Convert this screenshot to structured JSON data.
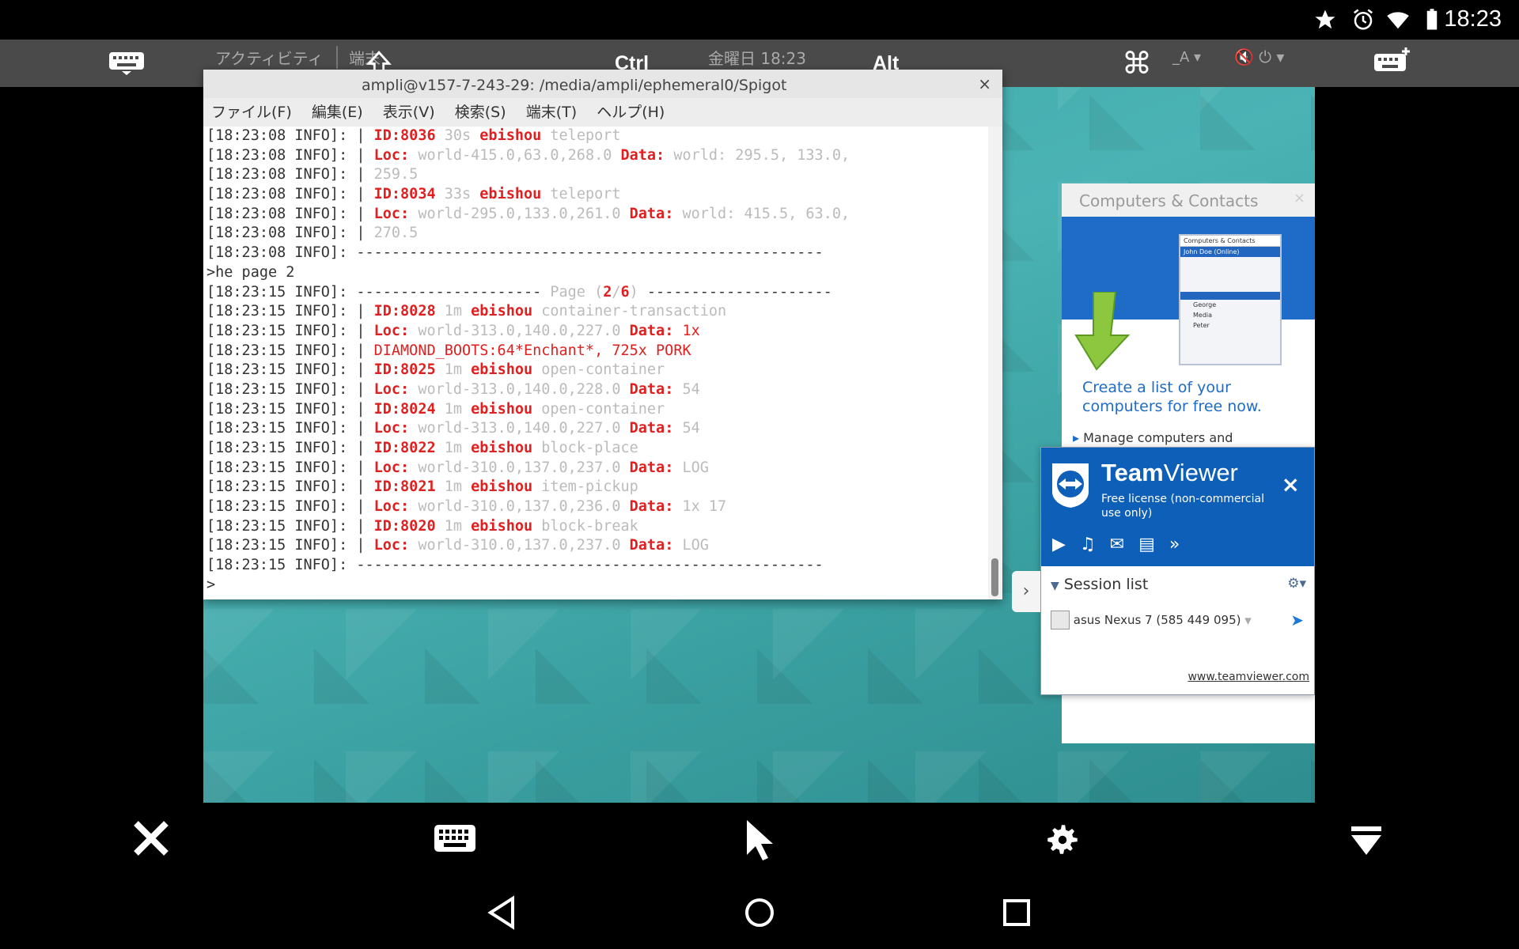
{
  "status_bar": {
    "time": "18:23",
    "icons": [
      "star-icon",
      "alarm-icon",
      "wifi-icon",
      "battery-icon"
    ]
  },
  "gnome_bar": {
    "activities": "アクティビティ",
    "app_menu": "端末",
    "clock": "金曜日 18:23"
  },
  "tv_toolbar": {
    "ctrl": "Ctrl",
    "alt": "Alt"
  },
  "terminal": {
    "title": "ampli@v157-7-243-29: /media/ampli/ephemeral0/Spigot",
    "menu": [
      "ファイル(F)",
      "編集(E)",
      "表示(V)",
      "検索(S)",
      "端末(T)",
      "ヘルプ(H)"
    ],
    "lines": [
      {
        "p": "[18:23:08 INFO]: | ",
        "s": [
          {
            "t": "ID:8036",
            "c": "red"
          },
          {
            "t": " 30s ",
            "c": "grey"
          },
          {
            "t": "ebishou",
            "c": "red"
          },
          {
            "t": " teleport",
            "c": "grey"
          }
        ]
      },
      {
        "p": "[18:23:08 INFO]: | ",
        "s": [
          {
            "t": "Loc:",
            "c": "red"
          },
          {
            "t": " world-415.0,63.0,268.0 ",
            "c": "grey"
          },
          {
            "t": "Data:",
            "c": "red"
          },
          {
            "t": " world: 295.5, 133.0,",
            "c": "grey"
          }
        ]
      },
      {
        "p": "[18:23:08 INFO]: | ",
        "s": [
          {
            "t": "259.5",
            "c": "grey"
          }
        ]
      },
      {
        "p": "[18:23:08 INFO]: | ",
        "s": [
          {
            "t": "ID:8034",
            "c": "red"
          },
          {
            "t": " 33s ",
            "c": "grey"
          },
          {
            "t": "ebishou",
            "c": "red"
          },
          {
            "t": " teleport",
            "c": "grey"
          }
        ]
      },
      {
        "p": "[18:23:08 INFO]: | ",
        "s": [
          {
            "t": "Loc:",
            "c": "red"
          },
          {
            "t": " world-295.0,133.0,261.0 ",
            "c": "grey"
          },
          {
            "t": "Data:",
            "c": "red"
          },
          {
            "t": " world: 415.5, 63.0,",
            "c": "grey"
          }
        ]
      },
      {
        "p": "[18:23:08 INFO]: | ",
        "s": [
          {
            "t": "270.5",
            "c": "grey"
          }
        ]
      },
      {
        "p": "[18:23:08 INFO]: -----------------------------------------------------",
        "s": []
      },
      {
        "p": ">he page 2",
        "s": []
      },
      {
        "p": "[18:23:15 INFO]: --------------------- ",
        "s": [
          {
            "t": "Page (",
            "c": "grey"
          },
          {
            "t": "2",
            "c": "red"
          },
          {
            "t": "/",
            "c": "grey"
          },
          {
            "t": "6",
            "c": "red"
          },
          {
            "t": ")",
            "c": "grey"
          },
          {
            "t": " ---------------------",
            "c": ""
          }
        ]
      },
      {
        "p": "[18:23:15 INFO]: | ",
        "s": [
          {
            "t": "ID:8028",
            "c": "red"
          },
          {
            "t": " 1m ",
            "c": "grey"
          },
          {
            "t": "ebishou",
            "c": "red"
          },
          {
            "t": " container-transaction",
            "c": "grey"
          }
        ]
      },
      {
        "p": "[18:23:15 INFO]: | ",
        "s": [
          {
            "t": "Loc:",
            "c": "red"
          },
          {
            "t": " world-313.0,140.0,227.0 ",
            "c": "grey"
          },
          {
            "t": "Data:",
            "c": "red"
          },
          {
            "t": " 1x",
            "c": "redp"
          }
        ]
      },
      {
        "p": "[18:23:15 INFO]: | ",
        "s": [
          {
            "t": "DIAMOND_BOOTS:64*Enchant*, 725x PORK",
            "c": "redp"
          }
        ]
      },
      {
        "p": "[18:23:15 INFO]: | ",
        "s": [
          {
            "t": "ID:8025",
            "c": "red"
          },
          {
            "t": " 1m ",
            "c": "grey"
          },
          {
            "t": "ebishou",
            "c": "red"
          },
          {
            "t": " open-container",
            "c": "grey"
          }
        ]
      },
      {
        "p": "[18:23:15 INFO]: | ",
        "s": [
          {
            "t": "Loc:",
            "c": "red"
          },
          {
            "t": " world-313.0,140.0,228.0 ",
            "c": "grey"
          },
          {
            "t": "Data:",
            "c": "red"
          },
          {
            "t": " 54",
            "c": "grey"
          }
        ]
      },
      {
        "p": "[18:23:15 INFO]: | ",
        "s": [
          {
            "t": "ID:8024",
            "c": "red"
          },
          {
            "t": " 1m ",
            "c": "grey"
          },
          {
            "t": "ebishou",
            "c": "red"
          },
          {
            "t": " open-container",
            "c": "grey"
          }
        ]
      },
      {
        "p": "[18:23:15 INFO]: | ",
        "s": [
          {
            "t": "Loc:",
            "c": "red"
          },
          {
            "t": " world-313.0,140.0,227.0 ",
            "c": "grey"
          },
          {
            "t": "Data:",
            "c": "red"
          },
          {
            "t": " 54",
            "c": "grey"
          }
        ]
      },
      {
        "p": "[18:23:15 INFO]: | ",
        "s": [
          {
            "t": "ID:8022",
            "c": "red"
          },
          {
            "t": " 1m ",
            "c": "grey"
          },
          {
            "t": "ebishou",
            "c": "red"
          },
          {
            "t": " block-place",
            "c": "grey"
          }
        ]
      },
      {
        "p": "[18:23:15 INFO]: | ",
        "s": [
          {
            "t": "Loc:",
            "c": "red"
          },
          {
            "t": " world-310.0,137.0,237.0 ",
            "c": "grey"
          },
          {
            "t": "Data:",
            "c": "red"
          },
          {
            "t": " LOG",
            "c": "grey"
          }
        ]
      },
      {
        "p": "[18:23:15 INFO]: | ",
        "s": [
          {
            "t": "ID:8021",
            "c": "red"
          },
          {
            "t": " 1m ",
            "c": "grey"
          },
          {
            "t": "ebishou",
            "c": "red"
          },
          {
            "t": " item-pickup",
            "c": "grey"
          }
        ]
      },
      {
        "p": "[18:23:15 INFO]: | ",
        "s": [
          {
            "t": "Loc:",
            "c": "red"
          },
          {
            "t": " world-310.0,137.0,236.0 ",
            "c": "grey"
          },
          {
            "t": "Data:",
            "c": "red"
          },
          {
            "t": " 1x 17",
            "c": "grey"
          }
        ]
      },
      {
        "p": "[18:23:15 INFO]: | ",
        "s": [
          {
            "t": "ID:8020",
            "c": "red"
          },
          {
            "t": " 1m ",
            "c": "grey"
          },
          {
            "t": "ebishou",
            "c": "red"
          },
          {
            "t": " block-break",
            "c": "grey"
          }
        ]
      },
      {
        "p": "[18:23:15 INFO]: | ",
        "s": [
          {
            "t": "Loc:",
            "c": "red"
          },
          {
            "t": " world-310.0,137.0,237.0 ",
            "c": "grey"
          },
          {
            "t": "Data:",
            "c": "red"
          },
          {
            "t": " LOG",
            "c": "grey"
          }
        ]
      },
      {
        "p": "[18:23:15 INFO]: -----------------------------------------------------",
        "s": []
      },
      {
        "p": ">",
        "s": []
      }
    ]
  },
  "computers_contacts": {
    "title": "Computers & Contacts",
    "mini_title": "Computers & Contacts",
    "mini_user": "John Doe (Online)",
    "mini_items": [
      "George",
      "Media",
      "Peter"
    ],
    "tagline": "Create a list of your computers for free now.",
    "bullet": "Manage computers and"
  },
  "teamviewer": {
    "brand_bold": "Team",
    "brand_light": "Viewer",
    "license": "Free license (non-commercial use only)",
    "session_header": "Session list",
    "session_item": "asus Nexus 7 (585 449 095)",
    "link": "www.teamviewer.com"
  },
  "colors": {
    "accent_red": "#e02020",
    "teamviewer_blue": "#0e5fb8",
    "desktop_teal": "#3aa5a6"
  }
}
